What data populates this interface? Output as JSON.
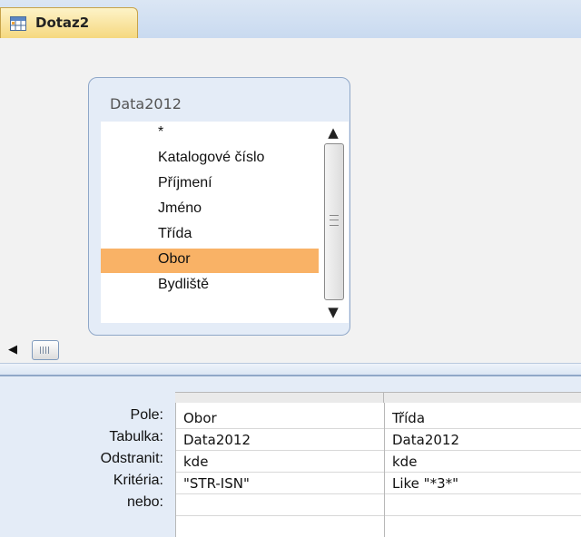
{
  "tab": {
    "label": "Dotaz2",
    "icon": "query-icon"
  },
  "table": {
    "title": "Data2012",
    "fields": [
      "*",
      "Katalogové číslo",
      "Příjmení",
      "Jméno",
      "Třída",
      "Obor",
      "Bydliště"
    ],
    "selected_field": "Obor"
  },
  "grid": {
    "row_labels": {
      "field": "Pole:",
      "table": "Tabulka:",
      "remove": "Odstranit:",
      "criteria": "Kritéria:",
      "or": "nebo:"
    },
    "columns": [
      {
        "field": "Obor",
        "table": "Data2012",
        "remove": "kde",
        "criteria": "\"STR-ISN\"",
        "or": ""
      },
      {
        "field": "Třída",
        "table": "Data2012",
        "remove": "kde",
        "criteria": "Like \"*3*\"",
        "or": ""
      }
    ]
  },
  "colors": {
    "selection": "#f9b266",
    "tab": "#f9e4a0",
    "pane_background": "#e4ecf7"
  }
}
